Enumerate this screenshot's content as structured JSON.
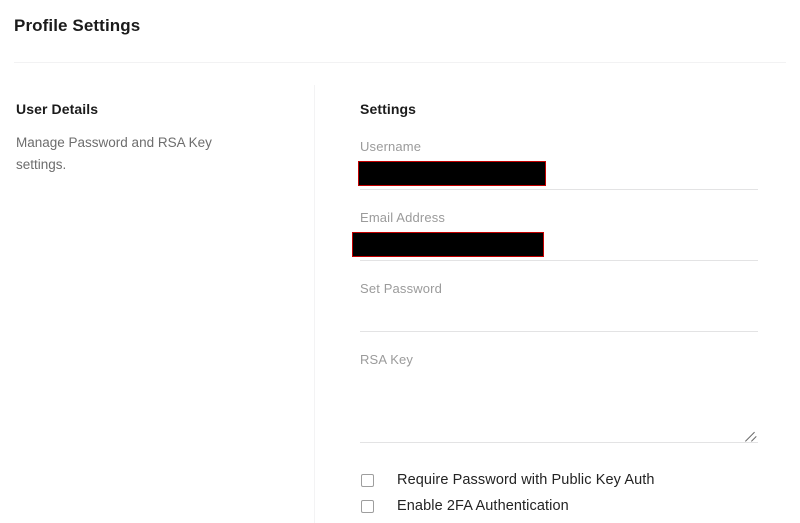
{
  "header": {
    "title": "Profile Settings"
  },
  "left_panel": {
    "heading": "User Details",
    "description": "Manage Password and RSA Key settings."
  },
  "settings_panel": {
    "heading": "Settings",
    "fields": [
      {
        "label": "Username",
        "value": "",
        "placeholder": "",
        "redacted": true
      },
      {
        "label": "Email Address",
        "value": "",
        "placeholder": "",
        "redacted": true
      },
      {
        "label": "Set Password",
        "value": "",
        "placeholder": "",
        "redacted": false
      },
      {
        "label": "RSA Key",
        "value": "",
        "placeholder": "",
        "redacted": false
      }
    ],
    "checkboxes": [
      {
        "label": "Require Password with Public Key Auth",
        "checked": false
      },
      {
        "label": "Enable 2FA Authentication",
        "checked": false
      }
    ]
  },
  "colors": {
    "background": "#ffffff",
    "text_primary": "#212121",
    "text_muted": "#6d6d6d",
    "label_gray": "#9b9b9b",
    "divider": "#f2f2f3",
    "input_underline": "#e3e3e4",
    "redaction_fill": "#000000",
    "redaction_border": "#c20000"
  }
}
